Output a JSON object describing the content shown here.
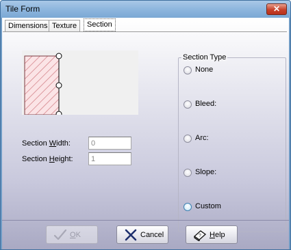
{
  "window": {
    "title": "Tile Form"
  },
  "close_button": {
    "symbol": "✕"
  },
  "tabs": [
    {
      "label": "Dimensions",
      "active": false
    },
    {
      "label": "Texture",
      "active": false
    },
    {
      "label": "Section",
      "active": true
    }
  ],
  "section_width": {
    "label_pre": "Section ",
    "label_ul": "W",
    "label_post": "idth:",
    "value": "0"
  },
  "section_height": {
    "label_pre": "Section ",
    "label_ul": "H",
    "label_post": "eight:",
    "value": "1"
  },
  "section_type": {
    "title": "Section Type",
    "options": [
      {
        "label": "None",
        "selected": false
      },
      {
        "label": "Bleed:",
        "selected": false
      },
      {
        "label": "Arc:",
        "selected": false
      },
      {
        "label": "Slope:",
        "selected": false
      },
      {
        "label": "Custom",
        "selected": false,
        "highlighted": true
      }
    ]
  },
  "buttons": {
    "ok": {
      "label_ul": "O",
      "label_rest": "K",
      "enabled": false
    },
    "cancel": {
      "label": "Cancel",
      "enabled": true
    },
    "help": {
      "label_ul": "H",
      "label_rest": "elp",
      "enabled": true
    }
  },
  "colors": {
    "title_bar": "#8eb6de",
    "close_button": "#c7412a",
    "hatch": "#d07a80",
    "preview_fill": "#fbe4e6"
  }
}
